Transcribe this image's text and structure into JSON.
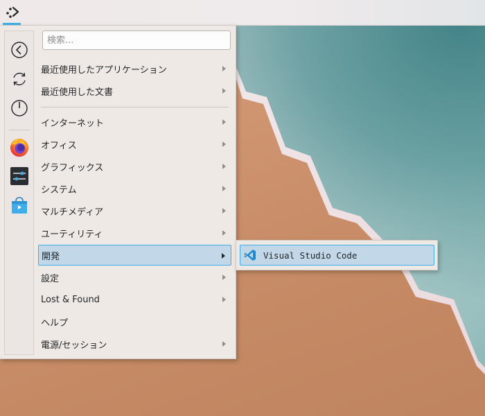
{
  "search": {
    "placeholder": "検索..."
  },
  "favorites": [
    {
      "icon": "back-arrow-icon"
    },
    {
      "icon": "refresh-icon"
    },
    {
      "icon": "power-icon"
    },
    {
      "icon": "firefox-icon"
    },
    {
      "icon": "settings-sliders-icon"
    },
    {
      "icon": "discover-store-icon"
    }
  ],
  "categories": [
    {
      "label": "最近使用したアプリケーション",
      "has_submenu": true
    },
    {
      "label": "最近使用した文書",
      "has_submenu": true
    },
    {
      "label": "インターネット",
      "has_submenu": true
    },
    {
      "label": "オフィス",
      "has_submenu": true
    },
    {
      "label": "グラフィックス",
      "has_submenu": true
    },
    {
      "label": "システム",
      "has_submenu": true
    },
    {
      "label": "マルチメディア",
      "has_submenu": true
    },
    {
      "label": "ユーティリティ",
      "has_submenu": true
    },
    {
      "label": "開発",
      "has_submenu": true,
      "active": true
    },
    {
      "label": "設定",
      "has_submenu": true
    },
    {
      "label": "Lost & Found",
      "has_submenu": true
    },
    {
      "label": "ヘルプ",
      "has_submenu": false
    },
    {
      "label": "電源/セッション",
      "has_submenu": true
    }
  ],
  "submenu": {
    "items": [
      {
        "label": "Visual Studio Code",
        "icon": "vscode-icon"
      }
    ]
  },
  "colors": {
    "accent": "#3daee9",
    "highlight": "#c2d8e8",
    "menu_bg": "#efe9e6"
  }
}
